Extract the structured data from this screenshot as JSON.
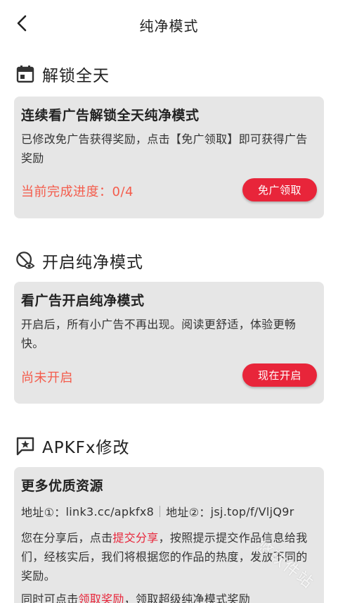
{
  "header": {
    "title": "纯净模式"
  },
  "sections": {
    "unlock_day": {
      "title": "解锁全天",
      "card_title": "连续看广告解锁全天纯净模式",
      "desc": "已修改免广告获得奖励，点击【免广领取】即可获得广告奖励",
      "status": "当前完成进度：0/4",
      "button": "免广领取",
      "progress": {
        "done": 0,
        "total": 4
      }
    },
    "pure_mode": {
      "title": "开启纯净模式",
      "card_title": "看广告开启纯净模式",
      "desc": "开启后，所有小广告不再出现。阅读更舒适，体验更畅快。",
      "status": "尚未开启",
      "button": "现在开启"
    },
    "apkfx": {
      "title": "APKFx修改",
      "card_title": "更多优质资源",
      "addr1_label": "地址①：",
      "addr1": "link3.cc/apkfx8",
      "addr2_label": "地址②：",
      "addr2": "jsj.top/f/VljQ9r",
      "desc_prefix": "您在分享后，点击",
      "desc_link": "提交分享",
      "desc_suffix": "，按照提示提交作品信息给我们，经核实后，我们将根据您的作品的热度，发放不同的奖励。",
      "desc2_prefix": "同时可点击",
      "desc2_link": "领取奖励",
      "desc2_suffix": "，领取超级纯净模式奖励"
    }
  },
  "watermark": "·悠软件站",
  "colors": {
    "accent": "#e8253a",
    "status": "#f45c4c",
    "card_bg": "#e6e6e6"
  },
  "icons": [
    "back-arrow-icon",
    "calendar-icon",
    "eye-off-icon",
    "chat-star-icon"
  ]
}
